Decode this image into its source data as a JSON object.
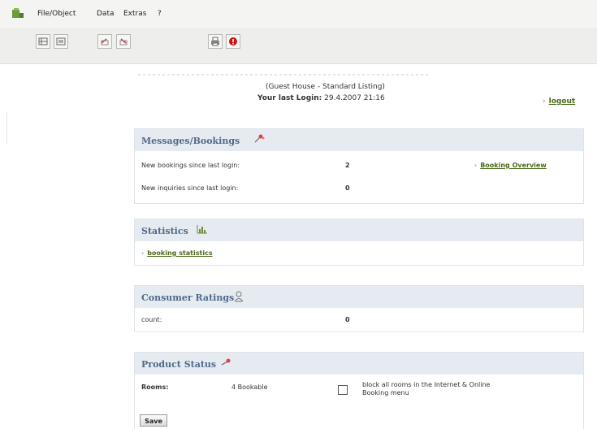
{
  "menu": {
    "items": [
      "File/Object",
      "Data",
      "Extras",
      "?"
    ]
  },
  "header": {
    "listing": "(Guest House - Standard Listing)",
    "last_login_label": "Your last Login:",
    "last_login_value": "29.4.2007  21:16",
    "logout_label": "logout"
  },
  "messages": {
    "title": "Messages/Bookings",
    "new_bookings_label": "New bookings since last login:",
    "new_bookings_value": "2",
    "booking_overview_label": "Booking Overview",
    "new_inquiries_label": "New inquiries since last login:",
    "new_inquiries_value": "0"
  },
  "statistics": {
    "title": "Statistics",
    "link_label": "booking statistics"
  },
  "ratings": {
    "title": "Consumer Ratings",
    "count_label": "count:",
    "count_value": "0"
  },
  "product": {
    "title": "Product Status",
    "rooms_label": "Rooms:",
    "rooms_value": "4 Bookable",
    "block_label_line1": "block all rooms in the Internet & Online",
    "block_label_line2": "Booking menu",
    "block_checked": false
  },
  "save_label": "Save",
  "colors": {
    "panel_header_bg": "#e6ebf1",
    "panel_title": "#4e6a8a",
    "link": "#4a6a1a"
  }
}
